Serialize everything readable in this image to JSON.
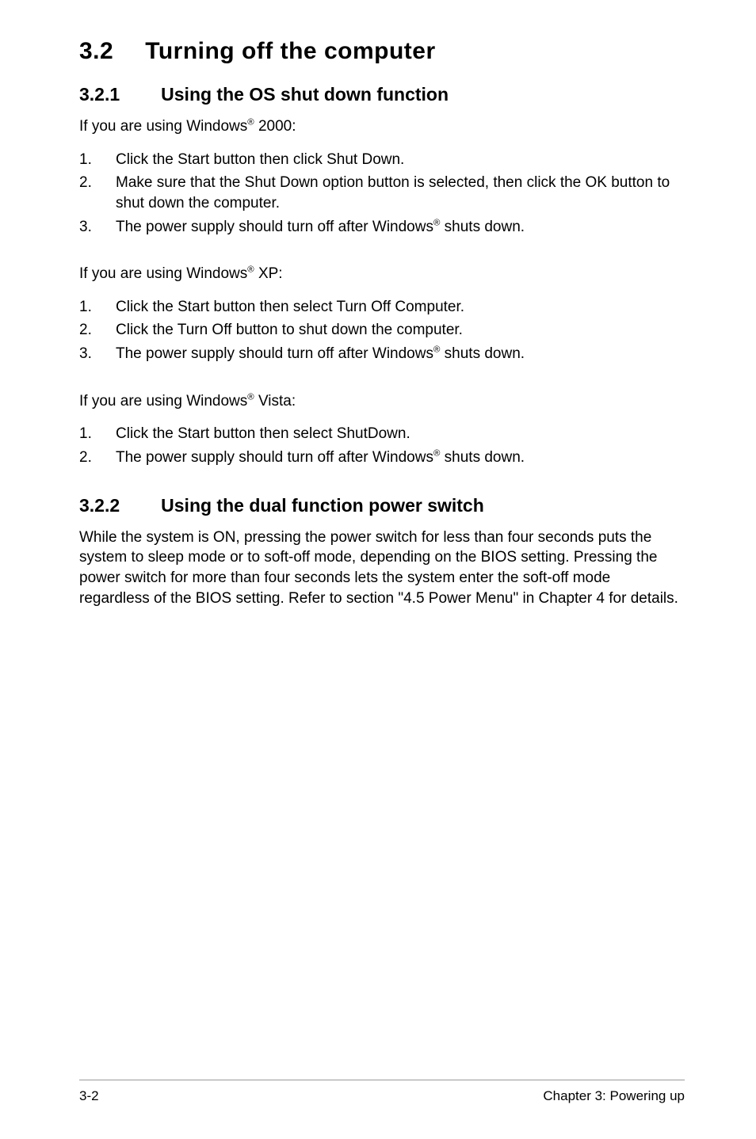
{
  "heading": {
    "number": "3.2",
    "title": "Turning off the computer"
  },
  "s1": {
    "number": "3.2.1",
    "title": "Using the OS shut down function",
    "intro2000_a": "If you are using Windows",
    "intro2000_b": " 2000:",
    "list2000": {
      "n1": "1.",
      "t1": "Click the Start button then click Shut Down.",
      "n2": "2.",
      "t2": "Make sure that the Shut Down option button is selected, then click the OK button to shut down the computer.",
      "n3": "3.",
      "t3a": "The power supply should turn off after Windows",
      "t3b": " shuts down."
    },
    "introXP_a": "If you are using Windows",
    "introXP_b": " XP:",
    "listXP": {
      "n1": "1.",
      "t1": "Click the Start button then select Turn Off Computer.",
      "n2": "2.",
      "t2": "Click the Turn Off button to shut down the computer.",
      "n3": "3.",
      "t3a": "The power supply should turn off after Windows",
      "t3b": " shuts down."
    },
    "introVista_a": "If you are using Windows",
    "introVista_b": " Vista:",
    "listVista": {
      "n1": "1.",
      "t1": "Click the Start button then select ShutDown.",
      "n2": "2.",
      "t2a": "The power supply should turn off after Windows",
      "t2b": " shuts down."
    }
  },
  "s2": {
    "number": "3.2.2",
    "title": "Using the dual function power switch",
    "para": "While the system is ON, pressing the power switch for less than four seconds puts the system to sleep mode or to soft-off mode, depending on the BIOS setting. Pressing the power switch for more than four seconds lets the system enter the soft-off mode regardless of the BIOS setting. Refer to section  \"4.5  Power Menu\" in Chapter 4 for details."
  },
  "reg": "®",
  "footer": {
    "left": "3-2",
    "right": "Chapter 3: Powering up"
  }
}
